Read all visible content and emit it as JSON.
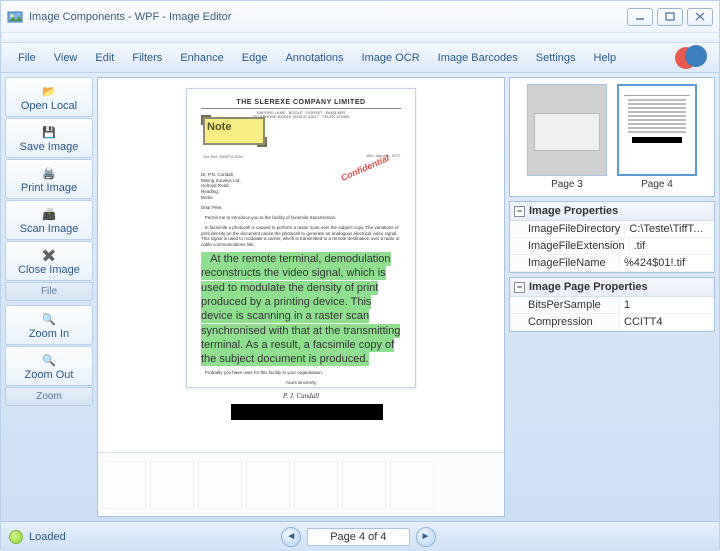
{
  "window": {
    "title": "Image Components - WPF - Image Editor"
  },
  "menu": {
    "items": [
      "File",
      "View",
      "Edit",
      "Filters",
      "Enhance",
      "Edge",
      "Annotations",
      "Image OCR",
      "Image Barcodes",
      "Settings",
      "Help"
    ]
  },
  "sidebar": {
    "group_file_label": "File",
    "group_zoom_label": "Zoom",
    "file_buttons": [
      {
        "label": "Open Local",
        "name": "open-local-button"
      },
      {
        "label": "Save Image",
        "name": "save-image-button"
      },
      {
        "label": "Print Image",
        "name": "print-image-button"
      },
      {
        "label": "Scan Image",
        "name": "scan-image-button"
      },
      {
        "label": "Close Image",
        "name": "close-image-button"
      }
    ],
    "zoom_buttons": [
      {
        "label": "Zoom In",
        "name": "zoom-in-button"
      },
      {
        "label": "Zoom Out",
        "name": "zoom-out-button"
      }
    ]
  },
  "document": {
    "company_header": "THE SLEREXE COMPANY LIMITED",
    "note_label": "Note",
    "stamp_text": "Confidential"
  },
  "thumbnails": {
    "items": [
      {
        "label": "Page 3",
        "name": "thumbnail-page-3"
      },
      {
        "label": "Page 4",
        "name": "thumbnail-page-4"
      }
    ]
  },
  "props_image": {
    "header": "Image Properties",
    "rows": [
      {
        "k": "ImageFileDirectory",
        "v": "C:\\Teste\\TiffTest\\"
      },
      {
        "k": "ImageFileExtension",
        "v": ".tif"
      },
      {
        "k": "ImageFileName",
        "v": "%424$01!.tif"
      }
    ]
  },
  "props_page": {
    "header": "Image Page Properties",
    "rows": [
      {
        "k": "BitsPerSample",
        "v": "1"
      },
      {
        "k": "Compression",
        "v": "CCITT4"
      }
    ]
  },
  "status": {
    "label": "Loaded",
    "page_text": "Page 4 of 4"
  }
}
